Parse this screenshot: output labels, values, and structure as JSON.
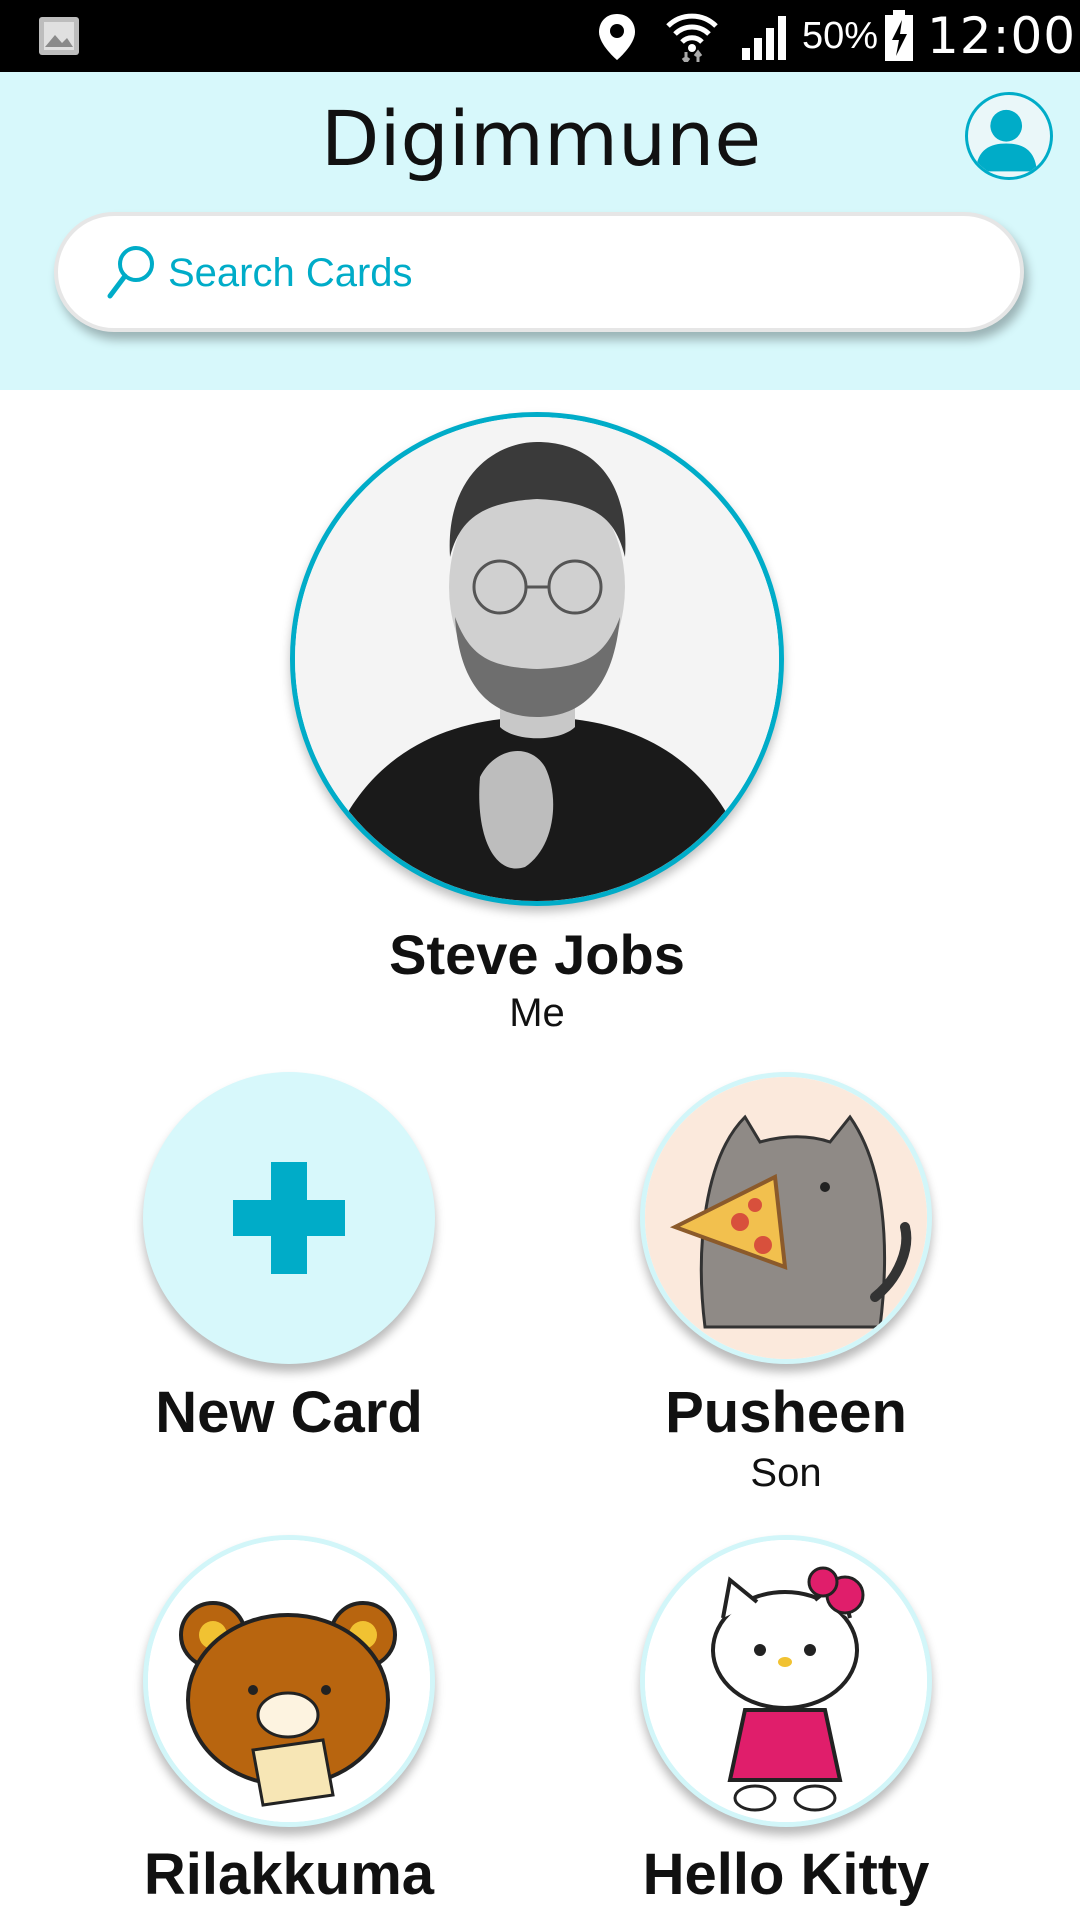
{
  "status_bar": {
    "battery_percent": "50%",
    "time": "12:00"
  },
  "app": {
    "logo_text": "Digimmune"
  },
  "search": {
    "placeholder": "Search Cards"
  },
  "primary_card": {
    "name": "Steve Jobs",
    "relation": "Me"
  },
  "cards": [
    {
      "name": "New Card",
      "relation": ""
    },
    {
      "name": "Pusheen",
      "relation": "Son"
    },
    {
      "name": "Rilakkuma",
      "relation": ""
    },
    {
      "name": "Hello Kitty",
      "relation": ""
    }
  ],
  "colors": {
    "accent": "#00acc8",
    "header_bg": "#d7f8fb",
    "status_bar_bg": "#000000"
  }
}
